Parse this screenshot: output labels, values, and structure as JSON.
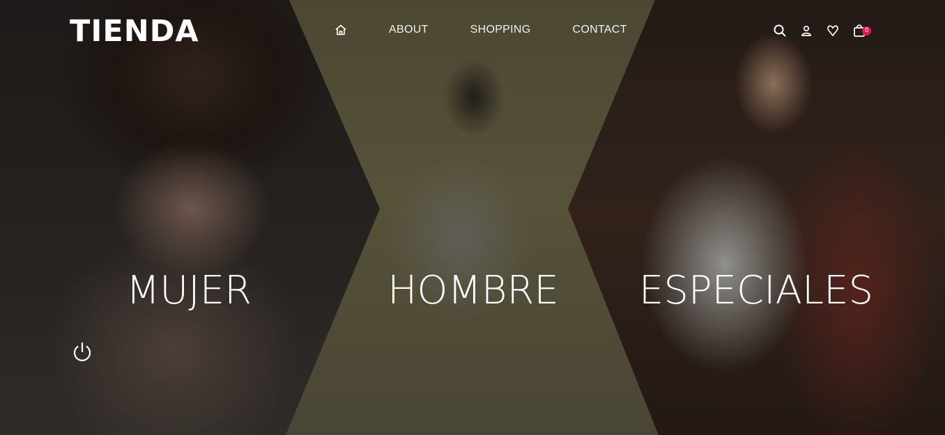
{
  "brand": {
    "logo": "TIENDA"
  },
  "nav": {
    "home_icon": "home-icon",
    "items": [
      {
        "label": "ABOUT"
      },
      {
        "label": "SHOPPING"
      },
      {
        "label": "CONTACT"
      }
    ]
  },
  "toolbar": {
    "icons": [
      "search-icon",
      "user-icon",
      "heart-icon",
      "bag-icon"
    ],
    "cart_count": "0",
    "badge_color": "#e5145a"
  },
  "categories": [
    {
      "label": "MUJER"
    },
    {
      "label": "HOMBRE"
    },
    {
      "label": "ESPECIALES"
    }
  ],
  "controls": {
    "power_icon": "power-icon"
  }
}
